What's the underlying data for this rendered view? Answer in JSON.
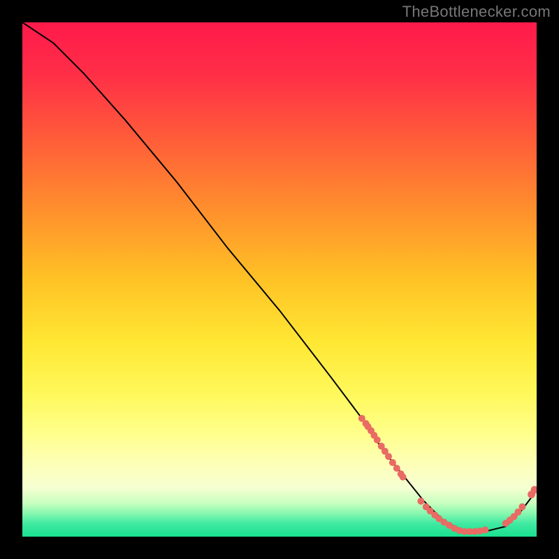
{
  "watermark": "TheBottlenecker.com",
  "colors": {
    "bg": "#000000",
    "gradient_stops": [
      {
        "offset": 0.0,
        "color": "#ff1a4b"
      },
      {
        "offset": 0.1,
        "color": "#ff2e47"
      },
      {
        "offset": 0.22,
        "color": "#ff5a3a"
      },
      {
        "offset": 0.35,
        "color": "#ff8a2e"
      },
      {
        "offset": 0.5,
        "color": "#ffc225"
      },
      {
        "offset": 0.62,
        "color": "#ffe733"
      },
      {
        "offset": 0.72,
        "color": "#fff85a"
      },
      {
        "offset": 0.8,
        "color": "#ffff8c"
      },
      {
        "offset": 0.86,
        "color": "#fdffb8"
      },
      {
        "offset": 0.905,
        "color": "#f6ffd2"
      },
      {
        "offset": 0.935,
        "color": "#c8ffbf"
      },
      {
        "offset": 0.955,
        "color": "#86f7af"
      },
      {
        "offset": 0.975,
        "color": "#3fe9a1"
      },
      {
        "offset": 1.0,
        "color": "#19e08f"
      }
    ],
    "line": "#000000",
    "dot": "#e96b64"
  },
  "chart_data": {
    "type": "line",
    "title": "",
    "xlabel": "",
    "ylabel": "",
    "xlim": [
      0,
      100
    ],
    "ylim": [
      0,
      100
    ],
    "series": [
      {
        "name": "bottleneck-curve",
        "x": [
          0,
          6,
          12,
          20,
          30,
          40,
          50,
          60,
          66,
          70,
          74,
          78,
          82,
          86,
          90,
          94,
          97,
          100
        ],
        "y": [
          100,
          96,
          90,
          81,
          69,
          56,
          44,
          31,
          23,
          17,
          12,
          7,
          3,
          1,
          1,
          2,
          5,
          9
        ]
      }
    ],
    "dot_clusters": [
      {
        "name": "descending-cluster",
        "points": [
          [
            66.0,
            23.0
          ],
          [
            66.8,
            22.0
          ],
          [
            67.2,
            21.4
          ],
          [
            67.8,
            20.6
          ],
          [
            68.4,
            19.7
          ],
          [
            69.0,
            18.8
          ],
          [
            69.8,
            17.6
          ],
          [
            70.5,
            16.6
          ],
          [
            71.2,
            15.6
          ],
          [
            72.0,
            14.4
          ],
          [
            72.8,
            13.3
          ],
          [
            73.6,
            12.2
          ],
          [
            74.0,
            11.6
          ]
        ]
      },
      {
        "name": "valley-cluster",
        "points": [
          [
            77.5,
            6.9
          ],
          [
            78.5,
            5.8
          ],
          [
            79.3,
            5.0
          ],
          [
            80.2,
            4.2
          ],
          [
            81.0,
            3.5
          ],
          [
            82.0,
            2.8
          ],
          [
            83.0,
            2.2
          ],
          [
            84.0,
            1.6
          ],
          [
            85.0,
            1.2
          ],
          [
            86.0,
            1.0
          ],
          [
            87.0,
            1.0
          ],
          [
            88.0,
            1.0
          ],
          [
            89.0,
            1.1
          ],
          [
            90.0,
            1.3
          ]
        ]
      },
      {
        "name": "rising-cluster",
        "points": [
          [
            94.0,
            2.6
          ],
          [
            94.8,
            3.2
          ],
          [
            95.6,
            3.9
          ],
          [
            96.4,
            4.8
          ],
          [
            97.2,
            5.8
          ]
        ]
      },
      {
        "name": "tail-pair",
        "points": [
          [
            99.0,
            8.2
          ],
          [
            99.6,
            9.1
          ]
        ]
      }
    ]
  }
}
